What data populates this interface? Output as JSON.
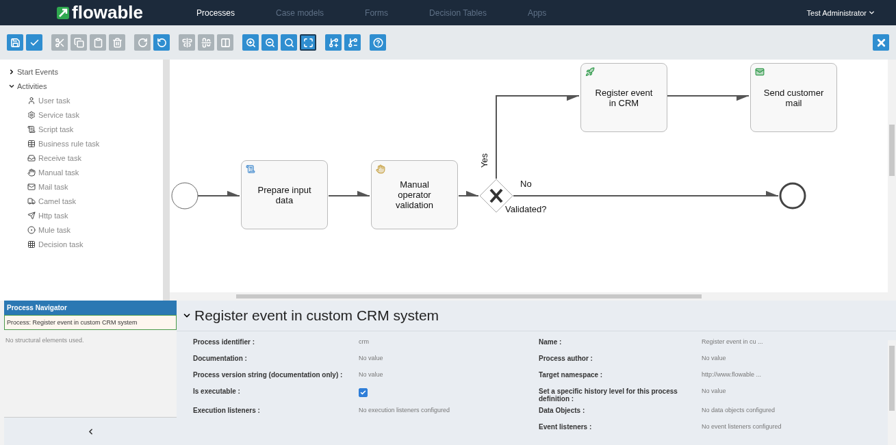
{
  "nav": {
    "logo": "flowable",
    "tabs": [
      {
        "label": "Processes",
        "selected": true
      },
      {
        "label": "Case models",
        "selected": false
      },
      {
        "label": "Forms",
        "selected": false
      },
      {
        "label": "Decision Tables",
        "selected": false
      },
      {
        "label": "Apps",
        "selected": false
      }
    ],
    "user": "Test Administrator"
  },
  "toolbar": {
    "groups": [
      {
        "items": [
          {
            "kind": "save",
            "disabled": false
          },
          {
            "kind": "validate",
            "disabled": false
          }
        ]
      },
      {
        "items": [
          {
            "kind": "cut",
            "disabled": true
          },
          {
            "kind": "copy",
            "disabled": true
          },
          {
            "kind": "paste",
            "disabled": true
          },
          {
            "kind": "delete",
            "disabled": true
          }
        ]
      },
      {
        "items": [
          {
            "kind": "redo",
            "disabled": true
          },
          {
            "kind": "undo",
            "disabled": false
          }
        ]
      },
      {
        "items": [
          {
            "kind": "align_vertical",
            "disabled": true
          },
          {
            "kind": "align_horizontal",
            "disabled": true
          },
          {
            "kind": "same_size",
            "disabled": true
          }
        ]
      },
      {
        "items": [
          {
            "kind": "zoom_in",
            "disabled": false,
            "selected": false
          },
          {
            "kind": "zoom_out",
            "disabled": false,
            "selected": false
          },
          {
            "kind": "zoom_actual",
            "disabled": false,
            "selected": false
          },
          {
            "kind": "zoom_fit",
            "disabled": false,
            "selected": true
          }
        ]
      },
      {
        "items": [
          {
            "kind": "add_bendpoint",
            "disabled": false
          },
          {
            "kind": "remove_bendpoint",
            "disabled": false
          }
        ]
      },
      {
        "items": [
          {
            "kind": "help",
            "disabled": false
          }
        ]
      }
    ]
  },
  "palette": {
    "groups": [
      {
        "label": "Start Events",
        "expanded": false
      },
      {
        "label": "Activities",
        "expanded": true,
        "items": [
          {
            "label": "User task",
            "kind": "user"
          },
          {
            "label": "Service task",
            "kind": "service"
          },
          {
            "label": "Script task",
            "kind": "script"
          },
          {
            "label": "Business rule task",
            "kind": "business_rule"
          },
          {
            "label": "Receive task",
            "kind": "receive"
          },
          {
            "label": "Manual task",
            "kind": "manual"
          },
          {
            "label": "Mail task",
            "kind": "mail"
          },
          {
            "label": "Camel task",
            "kind": "camel"
          },
          {
            "label": "Http task",
            "kind": "http"
          },
          {
            "label": "Mule task",
            "kind": "mule"
          },
          {
            "label": "Decision task",
            "kind": "decision"
          }
        ]
      }
    ]
  },
  "diagram": {
    "nodes": [
      {
        "kind": "start_event"
      },
      {
        "kind": "script_task",
        "label": "Prepare input data"
      },
      {
        "kind": "manual_task",
        "label": "Manual operator validation"
      },
      {
        "kind": "gateway",
        "label": "Validated?"
      },
      {
        "kind": "http_task",
        "label": "Register event in CRM"
      },
      {
        "kind": "mail_task",
        "label": "Send customer mail"
      },
      {
        "kind": "end_event"
      }
    ],
    "flow_labels": [
      "Yes",
      "No"
    ]
  },
  "navigator": {
    "title": "Process Navigator",
    "items": [
      {
        "label": "Process: Register event in custom CRM system",
        "selected": true
      }
    ],
    "note": "No structural elements used."
  },
  "properties": {
    "title": "Register event in custom CRM system",
    "expanded": true,
    "left": [
      {
        "label": "Process identifier :",
        "value": "crm"
      },
      {
        "label": "Documentation :",
        "value": "No value"
      },
      {
        "label": "Process version string (documentation only) :",
        "value": "No value"
      },
      {
        "label": "Is executable :",
        "kind": "checkbox",
        "checked": true
      },
      {
        "label": "Execution listeners :",
        "value": "No execution listeners configured"
      }
    ],
    "right": [
      {
        "label": "Name :",
        "value": "Register event in cu ..."
      },
      {
        "label": "Process author :",
        "value": "No value"
      },
      {
        "label": "Target namespace :",
        "value": "http://www.flowable ..."
      },
      {
        "label": "Set a specific history level for this process definition :",
        "value": "No value"
      },
      {
        "label": "Data Objects :",
        "value": "No data objects configured"
      },
      {
        "label": "Event listeners :",
        "value": "No event listeners configured"
      }
    ]
  }
}
